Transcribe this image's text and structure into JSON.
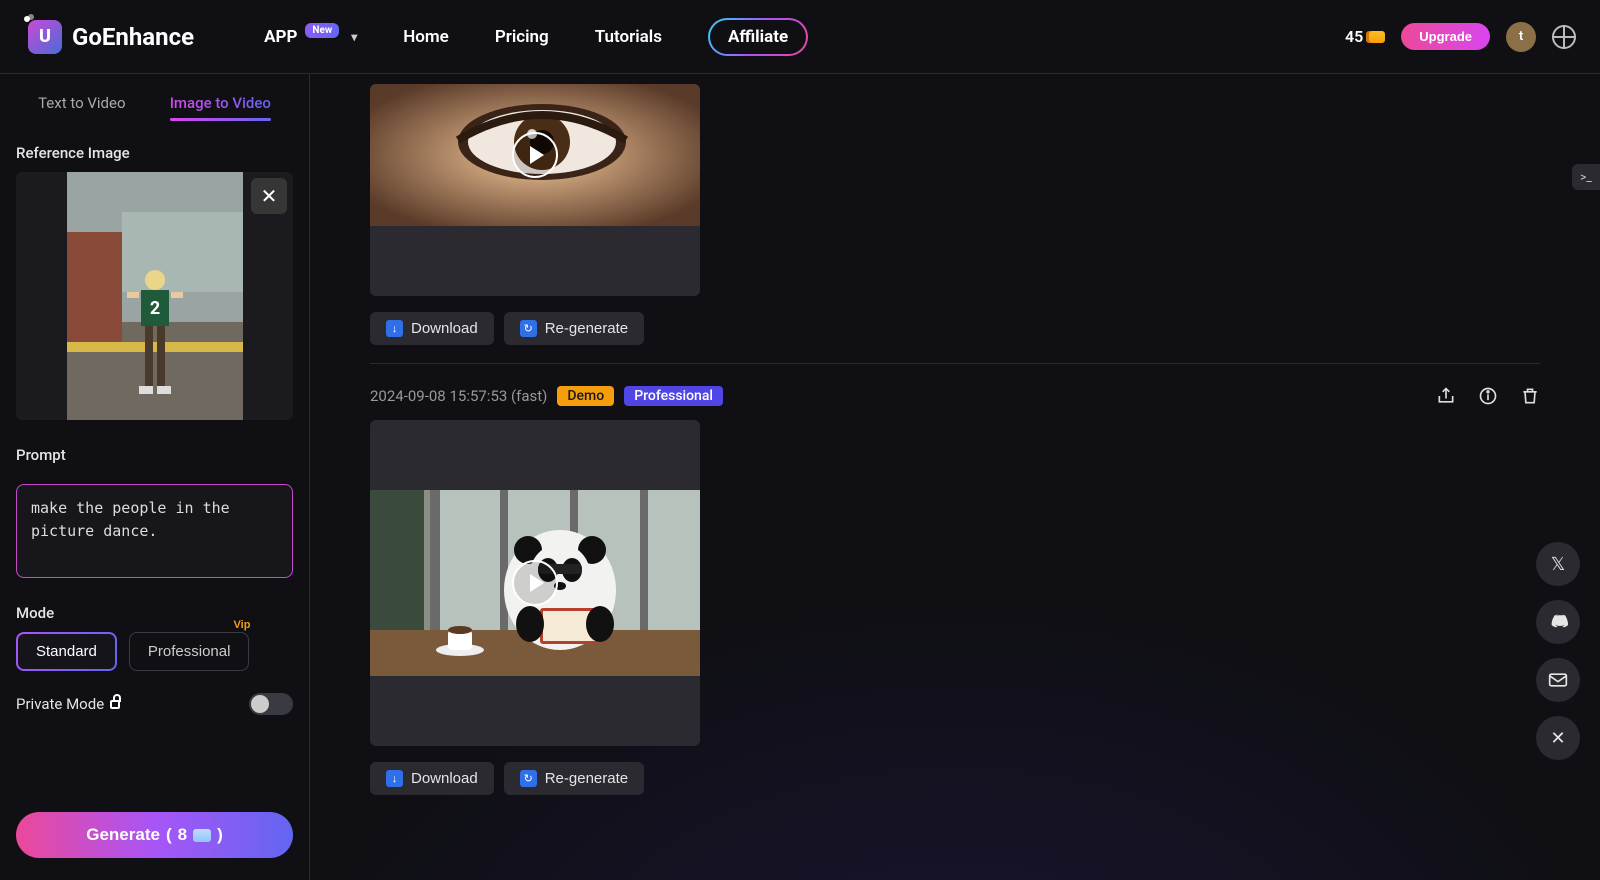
{
  "header": {
    "brand": "GoEnhance",
    "app_label": "APP",
    "app_badge": "New",
    "nav": {
      "home": "Home",
      "pricing": "Pricing",
      "tutorials": "Tutorials",
      "affiliate": "Affiliate"
    },
    "credits": "45",
    "upgrade": "Upgrade",
    "avatar_initial": "t"
  },
  "sidebar": {
    "tabs": {
      "text": "Text to Video",
      "image": "Image to Video"
    },
    "reference_label": "Reference Image",
    "prompt_label": "Prompt",
    "prompt_value": "make the people in the picture dance.",
    "mode_label": "Mode",
    "mode_standard": "Standard",
    "mode_professional": "Professional",
    "vip_tag": "Vip",
    "private_label": "Private Mode",
    "generate_label": "Generate",
    "generate_cost": "8"
  },
  "items": [
    {
      "timestamp": "",
      "badges": [],
      "download": "Download",
      "regenerate": "Re-generate",
      "show_meta": false
    },
    {
      "timestamp": "2024-09-08 15:57:53 (fast)",
      "badges": [
        {
          "text": "Demo",
          "type": "demo"
        },
        {
          "text": "Professional",
          "type": "pro"
        }
      ],
      "download": "Download",
      "regenerate": "Re-generate",
      "show_meta": true
    }
  ],
  "colors": {
    "accent_gradient_start": "#ec4899",
    "accent_gradient_mid": "#a855f7",
    "accent_gradient_end": "#6366f1",
    "badge_demo": "#f59e0b",
    "badge_pro": "#4f46e5"
  }
}
